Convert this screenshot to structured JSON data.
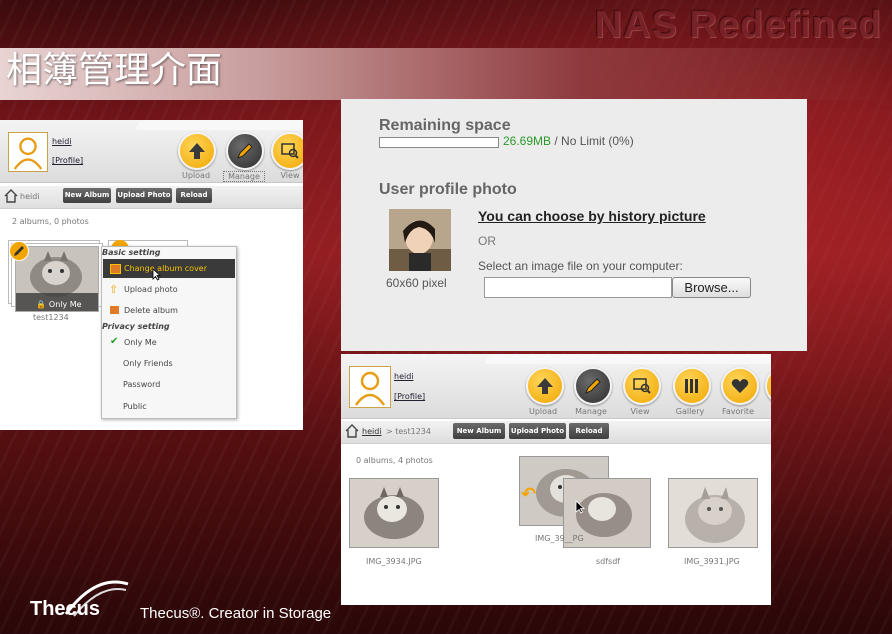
{
  "slide": {
    "brand_title": "NAS Redefined",
    "title": "相簿管理介面",
    "footer_logo": "Thecus",
    "footer_tagline": "Thecus®. Creator in Storage"
  },
  "shot1": {
    "username": "heidi",
    "profile_link": "[Profile]",
    "circle_buttons": [
      {
        "label": "Upload",
        "icon": "upload-arrow-icon"
      },
      {
        "label": "Manage",
        "icon": "pencil-icon"
      },
      {
        "label": "View",
        "icon": "image-search-icon"
      }
    ],
    "breadcrumb_user": "heidi",
    "toolbar_buttons": [
      "New Album",
      "Upload Photo",
      "Reload"
    ],
    "summary": "2 albums, 0 photos",
    "album": {
      "name": "test1234",
      "privacy_badge": "Only Me"
    },
    "menu": {
      "basic_heading": "Basic setting",
      "basic_items": [
        "Change album cover",
        "Upload photo",
        "Delete album"
      ],
      "privacy_heading": "Privacy setting",
      "privacy_items": [
        "Only Me",
        "Only Friends",
        "Password",
        "Public"
      ],
      "selected_privacy": "Only Me"
    }
  },
  "shot2": {
    "remaining_heading": "Remaining space",
    "remaining_value": "26.69MB",
    "remaining_limit": "/ No Limit (0%)",
    "progress_fraction": 0.0,
    "profile_heading": "User profile photo",
    "photo_caption": "60x60 pixel",
    "history_link": "You can choose by history picture",
    "or_text": "OR",
    "select_label": "Select an image file on your computer:",
    "browse_label": "Browse..."
  },
  "shot3": {
    "username": "heidi",
    "profile_link": "[Profile]",
    "circle_buttons": [
      {
        "label": "Upload",
        "icon": "upload-arrow-icon"
      },
      {
        "label": "Manage",
        "icon": "pencil-icon"
      },
      {
        "label": "View",
        "icon": "image-search-icon"
      },
      {
        "label": "Gallery",
        "icon": "gallery-icon"
      },
      {
        "label": "Favorite",
        "icon": "heart-icon"
      }
    ],
    "breadcrumb_user": "heidi",
    "breadcrumb_album": "> test1234",
    "toolbar_buttons": [
      "New Album",
      "Upload Photo",
      "Reload"
    ],
    "summary": "0 albums, 4 photos",
    "photos": [
      "IMG_3934.JPG",
      "IMG_39__PG",
      "sdfsdf",
      "IMG_3931.JPG"
    ]
  },
  "colors": {
    "accent_yellow": "#f0a500",
    "dark_button": "#3f3f3f",
    "slide_red": "#8a1c20",
    "green_value": "#2a9a2a"
  }
}
